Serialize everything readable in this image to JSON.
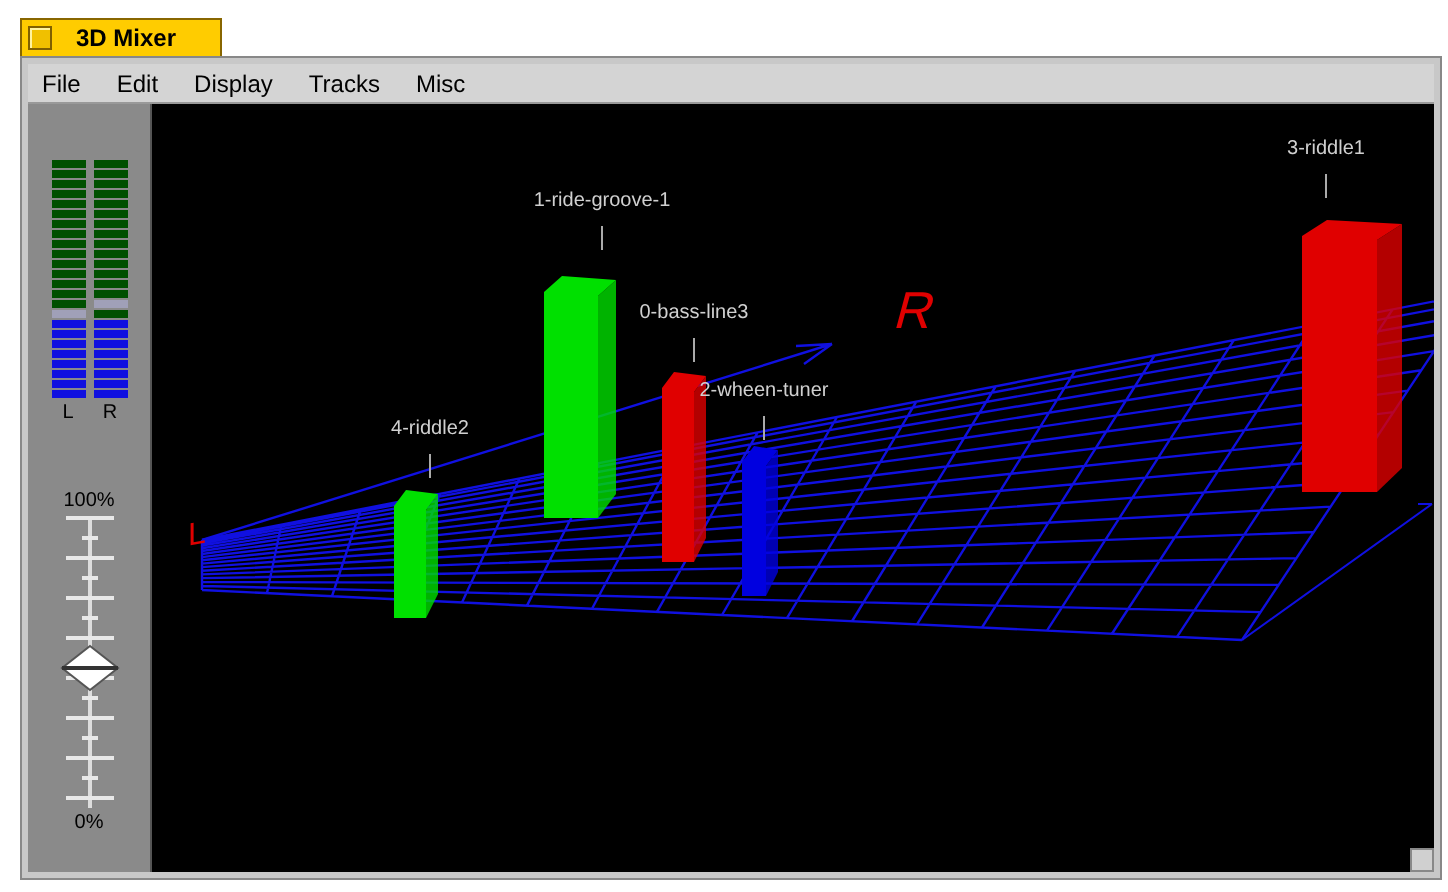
{
  "window": {
    "title": "3D Mixer"
  },
  "menu": [
    "File",
    "Edit",
    "Display",
    "Tracks",
    "Misc"
  ],
  "meters": [
    {
      "label": "L",
      "level": 0.33
    },
    {
      "label": "R",
      "level": 0.33
    }
  ],
  "volume": {
    "top_label": "100%",
    "bottom_label": "0%",
    "level": 0.48
  },
  "scene": {
    "axis_labels": [
      "L",
      "R"
    ],
    "tracks": [
      {
        "name": "0-bass-line3",
        "color": "#e00000"
      },
      {
        "name": "1-ride-groove-1",
        "color": "#00e000"
      },
      {
        "name": "2-wheen-tuner",
        "color": "#0000e0"
      },
      {
        "name": "3-riddle1",
        "color": "#e00000"
      },
      {
        "name": "4-riddle2",
        "color": "#00e000"
      }
    ]
  }
}
